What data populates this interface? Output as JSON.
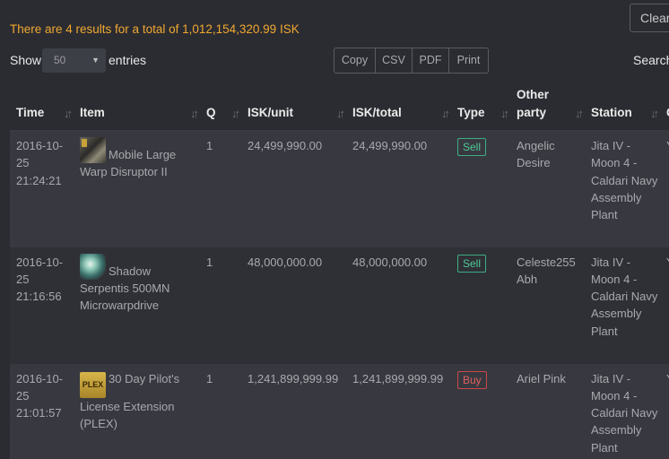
{
  "summary_text": "There are 4 results for a total of 1,012,154,320.99 ISK",
  "clear_button": "Clear",
  "length_control": {
    "show_label": "Show",
    "selected": "50",
    "entries_label": "entries"
  },
  "export_buttons": [
    "Copy",
    "CSV",
    "PDF",
    "Print"
  ],
  "search_label": "Search:",
  "columns": [
    "Time",
    "Item",
    "Q",
    "ISK/unit",
    "ISK/total",
    "Type",
    "Other party",
    "Station",
    "C"
  ],
  "rows": [
    {
      "time": "2016-10-25 21:24:21",
      "icon": "warp-disruptor-icon",
      "item": "Mobile Large Warp Disruptor II",
      "q": "1",
      "isk_unit": "24,499,990.00",
      "isk_total": "24,499,990.00",
      "type": "Sell",
      "party": "Angelic Desire",
      "station": "Jita IV - Moon 4 - Caldari Navy Assembly Plant",
      "client": "Y S"
    },
    {
      "time": "2016-10-25 21:16:56",
      "icon": "microwarpdrive-icon",
      "item": "Shadow Serpentis 500MN Microwarpdrive",
      "q": "1",
      "isk_unit": "48,000,000.00",
      "isk_total": "48,000,000.00",
      "type": "Sell",
      "party": "Celeste255 Abh",
      "station": "Jita IV - Moon 4 - Caldari Navy Assembly Plant",
      "client": "Y S"
    },
    {
      "time": "2016-10-25 21:01:57",
      "icon": "plex-icon",
      "icon_text": "PLEX",
      "item": "30 Day Pilot's License Extension (PLEX)",
      "q": "1",
      "isk_unit": "1,241,899,999.99",
      "isk_total": "1,241,899,999.99",
      "type": "Buy",
      "party": "Ariel Pink",
      "station": "Jita IV - Moon 4 - Caldari Navy Assembly Plant",
      "client": "Y S"
    }
  ],
  "colors": {
    "accent": "#f0a830",
    "sell": "#4ec995",
    "buy": "#e06060",
    "background": "#2b2c32"
  }
}
